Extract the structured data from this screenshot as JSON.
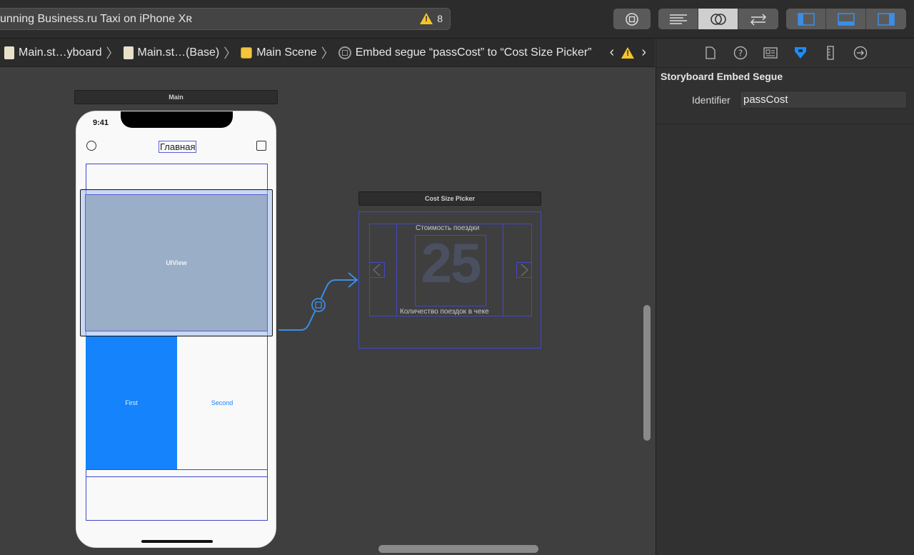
{
  "toolbar": {
    "status_text": "unning Business.ru Taxi on iPhone Xʀ",
    "warning_count": "8"
  },
  "jumpbar": {
    "crumbs": [
      "Main.st…yboard",
      "Main.st…(Base)",
      "Main Scene",
      "Embed segue “passCost” to “Cost Size Picker”"
    ]
  },
  "canvas": {
    "main_scene_title": "Main",
    "picker_scene_title": "Cost Size Picker",
    "phone": {
      "time": "9:41",
      "nav_title": "Главная",
      "uiview_label": "UIView",
      "first_label": "First",
      "second_label": "Second"
    },
    "picker": {
      "top_label": "Стоимость поездки",
      "number": "25",
      "bottom_label": "Количество поездок в чеке"
    }
  },
  "inspector": {
    "section_title": "Storyboard Embed Segue",
    "identifier_label": "Identifier",
    "identifier_value": "passCost"
  },
  "colors": {
    "accent_blue": "#1583fc",
    "warning_yellow": "#f5c52a",
    "outline_blue": "#4347c9"
  }
}
